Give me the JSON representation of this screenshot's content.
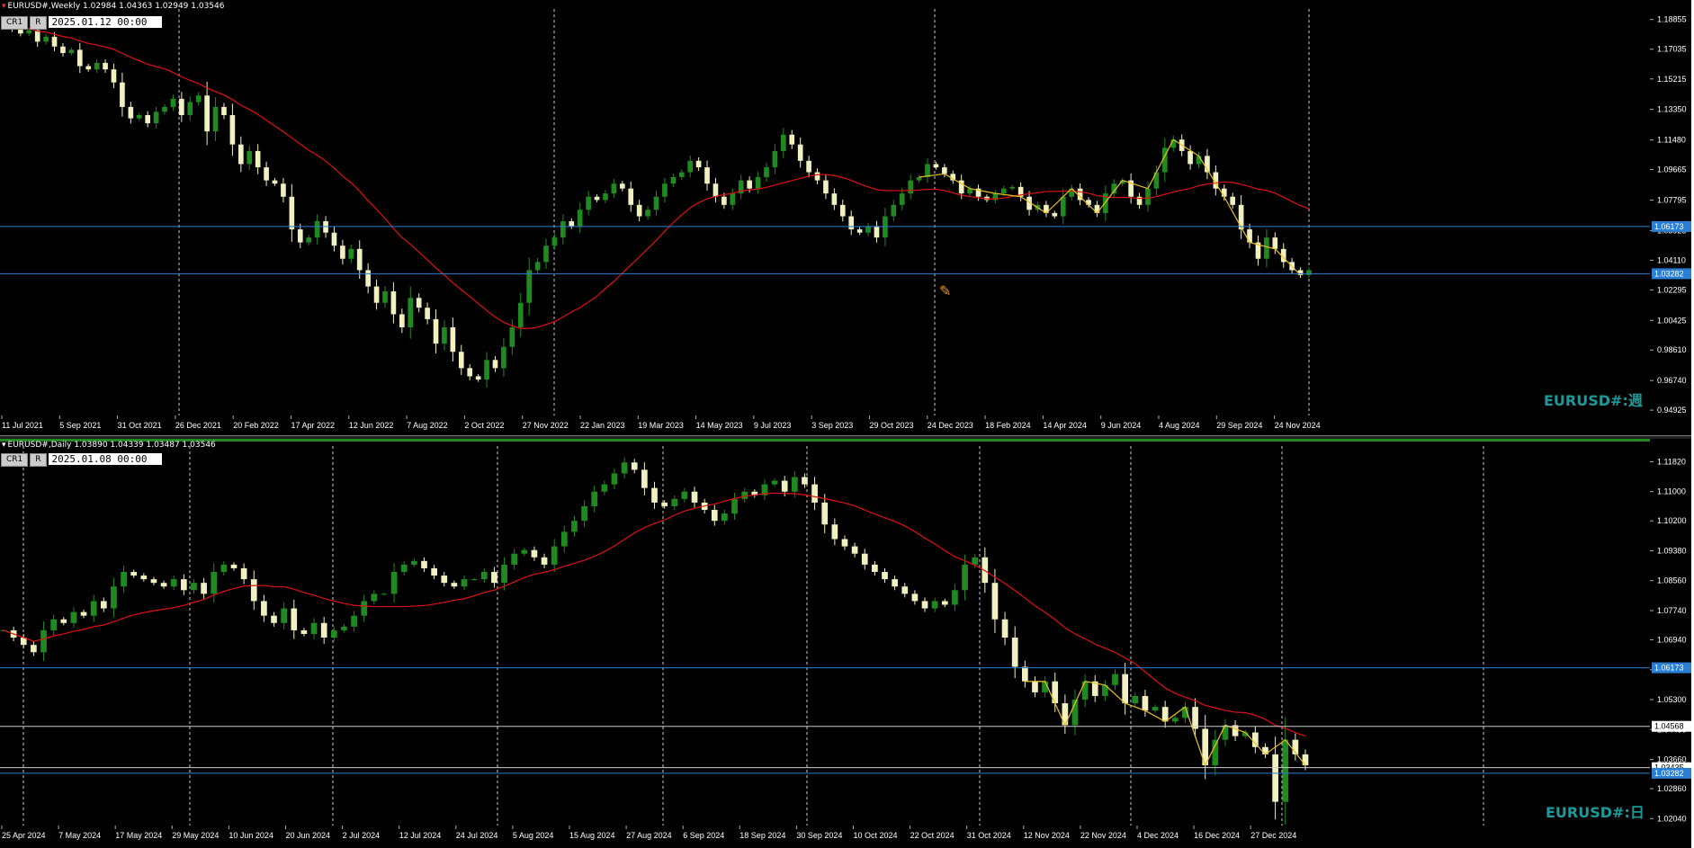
{
  "colors": {
    "background": "#000000",
    "bull": "#1f8a1f",
    "bear": "#f0f0c0",
    "ma": "#e01010",
    "zigzag": "#e8c020",
    "hline": "#2a7fd4",
    "vgrid": "#ffffff",
    "watermark": "#1a9a9a"
  },
  "top": {
    "header": "EURUSD#,Weekly  1.02984 1.04363 1.02949 1.03546",
    "cr_label": "CR1",
    "r_label": "R",
    "date_value": "2025.01.12 00:00",
    "watermark": "EURUSD#:週",
    "price_labels": [
      "1.18855",
      "1.17035",
      "1.15215",
      "1.13350",
      "1.11480",
      "1.09665",
      "1.07795",
      "1.05925",
      "1.04110",
      "1.02295",
      "1.00425",
      "0.98610",
      "0.96740",
      "0.94925"
    ],
    "hlines": [
      {
        "value": "1.06173"
      },
      {
        "value": "1.03282"
      }
    ],
    "time_labels": [
      "11 Jul 2021",
      "5 Sep 2021",
      "31 Oct 2021",
      "26 Dec 2021",
      "20 Feb 2022",
      "17 Apr 2022",
      "12 Jun 2022",
      "7 Aug 2022",
      "2 Oct 2022",
      "27 Nov 2022",
      "22 Jan 2023",
      "19 Mar 2023",
      "14 May 2023",
      "9 Jul 2023",
      "3 Sep 2023",
      "29 Oct 2023",
      "24 Dec 2023",
      "18 Feb 2024",
      "14 Apr 2024",
      "9 Jun 2024",
      "4 Aug 2024",
      "29 Sep 2024",
      "24 Nov 2024"
    ],
    "ylim": [
      0.946,
      1.195
    ],
    "close_path": [
      1.187,
      1.183,
      1.18,
      1.182,
      1.175,
      1.178,
      1.172,
      1.168,
      1.17,
      1.16,
      1.158,
      1.162,
      1.158,
      1.15,
      1.135,
      1.128,
      1.13,
      1.125,
      1.132,
      1.135,
      1.14,
      1.13,
      1.138,
      1.142,
      1.12,
      1.135,
      1.13,
      1.112,
      1.1,
      1.108,
      1.098,
      1.09,
      1.088,
      1.08,
      1.06,
      1.052,
      1.055,
      1.065,
      1.058,
      1.05,
      1.042,
      1.048,
      1.035,
      1.025,
      1.015,
      1.022,
      1.008,
      1.0,
      1.018,
      1.012,
      1.005,
      0.99,
      1.0,
      0.985,
      0.975,
      0.97,
      0.968,
      0.98,
      0.975,
      0.988,
      1.0,
      1.015,
      1.035,
      1.04,
      1.05,
      1.055,
      1.065,
      1.062,
      1.072,
      1.08,
      1.078,
      1.082,
      1.088,
      1.085,
      1.075,
      1.068,
      1.072,
      1.08,
      1.088,
      1.092,
      1.095,
      1.102,
      1.098,
      1.088,
      1.08,
      1.075,
      1.082,
      1.09,
      1.085,
      1.092,
      1.098,
      1.108,
      1.118,
      1.112,
      1.102,
      1.095,
      1.09,
      1.082,
      1.075,
      1.068,
      1.06,
      1.058,
      1.062,
      1.055,
      1.068,
      1.075,
      1.082,
      1.09,
      1.092,
      1.1,
      1.098,
      1.094,
      1.09,
      1.082,
      1.085,
      1.08,
      1.078,
      1.082,
      1.085,
      1.086,
      1.08,
      1.072,
      1.075,
      1.07,
      1.068,
      1.08,
      1.085,
      1.078,
      1.075,
      1.07,
      1.082,
      1.088,
      1.09,
      1.08,
      1.075,
      1.085,
      1.095,
      1.11,
      1.115,
      1.108,
      1.1,
      1.105,
      1.095,
      1.085,
      1.08,
      1.075,
      1.06,
      1.052,
      1.042,
      1.055,
      1.048,
      1.04,
      1.035,
      1.032,
      1.035
    ]
  },
  "bottom": {
    "header": "EURUSD#,Daily  1.03890 1.04339 1.03487 1.03546",
    "cr_label": "CR1",
    "r_label": "R",
    "date_value": "2025.01.08 00:00",
    "watermark": "EURUSD#:日",
    "price_labels": [
      "1.11820",
      "1.11000",
      "1.10200",
      "1.09380",
      "1.08560",
      "1.07740",
      "1.06940",
      "1.06120",
      "1.05300",
      "1.04480",
      "1.03660",
      "1.02860",
      "1.02040"
    ],
    "hlines": [
      {
        "value": "1.06173",
        "color": "#2a7fd4",
        "label_bg": "#2a7fd4"
      },
      {
        "value": "1.04568",
        "color": "#cccccc",
        "label_bg": "#ffffff"
      },
      {
        "value": "1.03435",
        "color": "#cccccc",
        "label_bg": "#ffffff"
      },
      {
        "value": "1.03282",
        "color": "#2a7fd4",
        "label_bg": "#2a7fd4"
      }
    ],
    "time_labels": [
      "25 Apr 2024",
      "7 May 2024",
      "17 May 2024",
      "29 May 2024",
      "10 Jun 2024",
      "20 Jun 2024",
      "2 Jul 2024",
      "12 Jul 2024",
      "24 Jul 2024",
      "5 Aug 2024",
      "15 Aug 2024",
      "27 Aug 2024",
      "6 Sep 2024",
      "18 Sep 2024",
      "30 Sep 2024",
      "10 Oct 2024",
      "22 Oct 2024",
      "31 Oct 2024",
      "12 Nov 2024",
      "22 Nov 2024",
      "4 Dec 2024",
      "16 Dec 2024",
      "27 Dec 2024"
    ],
    "ylim": [
      1.0185,
      1.1225
    ],
    "close_path": [
      1.072,
      1.07,
      1.068,
      1.066,
      1.072,
      1.075,
      1.074,
      1.077,
      1.076,
      1.08,
      1.078,
      1.084,
      1.088,
      1.087,
      1.086,
      1.085,
      1.084,
      1.086,
      1.083,
      1.085,
      1.082,
      1.088,
      1.09,
      1.089,
      1.086,
      1.08,
      1.076,
      1.074,
      1.078,
      1.072,
      1.071,
      1.074,
      1.07,
      1.072,
      1.073,
      1.076,
      1.08,
      1.082,
      1.082,
      1.088,
      1.09,
      1.091,
      1.089,
      1.087,
      1.085,
      1.084,
      1.086,
      1.086,
      1.088,
      1.085,
      1.09,
      1.093,
      1.094,
      1.092,
      1.09,
      1.095,
      1.099,
      1.102,
      1.106,
      1.11,
      1.112,
      1.115,
      1.118,
      1.116,
      1.111,
      1.107,
      1.106,
      1.108,
      1.11,
      1.107,
      1.105,
      1.102,
      1.104,
      1.108,
      1.11,
      1.109,
      1.112,
      1.113,
      1.11,
      1.114,
      1.112,
      1.107,
      1.101,
      1.097,
      1.095,
      1.093,
      1.09,
      1.088,
      1.086,
      1.084,
      1.082,
      1.08,
      1.078,
      1.08,
      1.079,
      1.083,
      1.09,
      1.092,
      1.085,
      1.075,
      1.07,
      1.062,
      1.058,
      1.055,
      1.058,
      1.052,
      1.046,
      1.053,
      1.058,
      1.054,
      1.057,
      1.06,
      1.052,
      1.054,
      1.05,
      1.051,
      1.047,
      1.048,
      1.051,
      1.045,
      1.035,
      1.042,
      1.046,
      1.043,
      1.044,
      1.04,
      1.038,
      1.025,
      1.042,
      1.038,
      1.035
    ]
  }
}
